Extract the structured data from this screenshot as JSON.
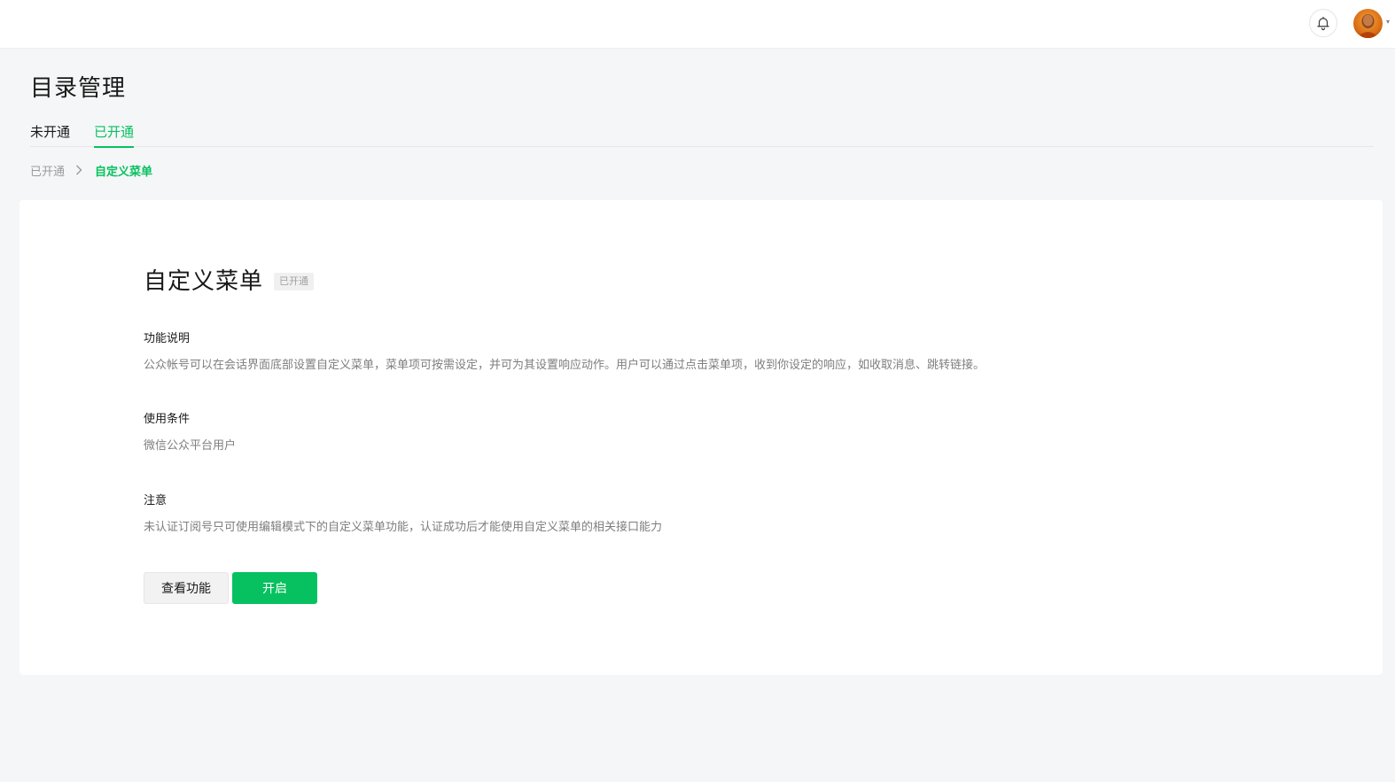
{
  "header": {
    "notification_icon": "bell-icon",
    "avatar_icon": "user-avatar",
    "avatar_caret_icon": "caret-down-icon"
  },
  "page": {
    "title": "目录管理"
  },
  "tabs": [
    {
      "label": "未开通",
      "active": false
    },
    {
      "label": "已开通",
      "active": true
    }
  ],
  "breadcrumb": {
    "parent": "已开通",
    "separator_icon": "chevron-right-icon",
    "current": "自定义菜单"
  },
  "feature": {
    "title": "自定义菜单",
    "status": "已开通",
    "sections": [
      {
        "title": "功能说明",
        "text": "公众帐号可以在会话界面底部设置自定义菜单，菜单项可按需设定，并可为其设置响应动作。用户可以通过点击菜单项，收到你设定的响应，如收取消息、跳转链接。"
      },
      {
        "title": "使用条件",
        "text": "微信公众平台用户"
      },
      {
        "title": "注意",
        "text": "未认证订阅号只可使用编辑模式下的自定义菜单功能，认证成功后才能使用自定义菜单的相关接口能力"
      }
    ],
    "buttons": {
      "view_label": "查看功能",
      "enable_label": "开启"
    }
  },
  "colors": {
    "accent": "#07c160",
    "background": "#f5f6f7",
    "text_secondary": "#7e7e7e"
  }
}
